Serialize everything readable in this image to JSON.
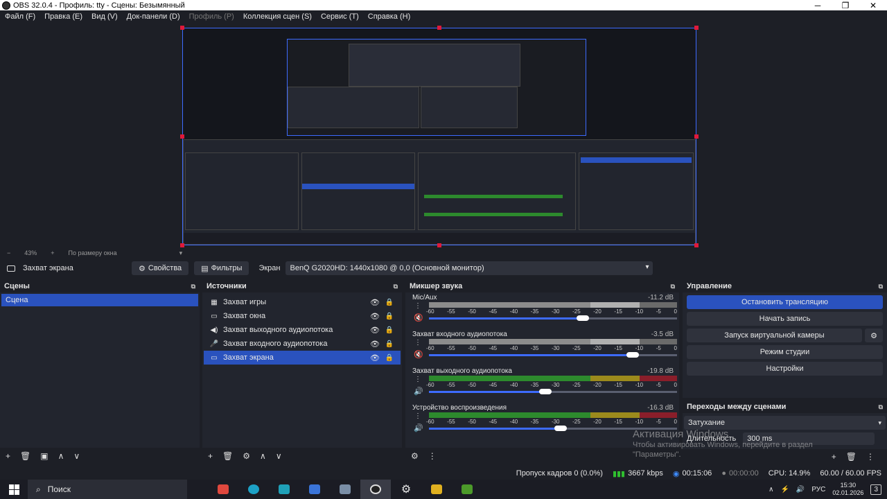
{
  "window": {
    "title": "OBS 32.0.4 - Профиль: tty - Сцены: Безымянный",
    "min": "─",
    "max": "❐",
    "close": "✕"
  },
  "menu": [
    "Файл (F)",
    "Правка (E)",
    "Вид (V)",
    "Док-панели (D)",
    "Профиль (P)",
    "Коллекция сцен (S)",
    "Сервис (T)",
    "Справка (H)"
  ],
  "zoom": {
    "minus": "−",
    "percent": "43%",
    "plus": "+",
    "fit_label": "По размеру окна",
    "arrow": "▾"
  },
  "context": {
    "source_name": "Захват экрана",
    "properties_label": "Свойства",
    "filters_label": "Фильтры",
    "screen_label": "Экран",
    "screen_value": "BenQ G2020HD: 1440x1080 @ 0,0 (Основной монитор)",
    "chevron": "▾"
  },
  "scenes": {
    "title": "Сцены",
    "popout": "⧉",
    "items": [
      "Сцена"
    ],
    "footer": [
      "+",
      "🗑",
      "▣",
      "∧",
      "∨"
    ]
  },
  "sources": {
    "title": "Источники",
    "popout": "⧉",
    "items": [
      {
        "icon": "▦",
        "label": "Захват игры",
        "eye": "👁",
        "lock": "🔒"
      },
      {
        "icon": "▭",
        "label": "Захват окна",
        "eye": "👁",
        "lock": "🔒"
      },
      {
        "icon": "◀)",
        "label": "Захват выходного аудиопотока",
        "eye": "👁",
        "lock": "🔒"
      },
      {
        "icon": "🎤",
        "label": "Захват входного аудиопотока",
        "eye": "👁",
        "lock": "🔒"
      },
      {
        "icon": "▭",
        "label": "Захват экрана",
        "eye": "👁",
        "lock": "🔒"
      }
    ],
    "footer": [
      "+",
      "🗑",
      "⚙",
      "∧",
      "∨"
    ]
  },
  "mixer": {
    "title": "Микшер звука",
    "popout": "⧉",
    "ticks": [
      "-60",
      "-55",
      "-50",
      "-45",
      "-40",
      "-35",
      "-30",
      "-25",
      "-20",
      "-15",
      "-10",
      "-5",
      "0"
    ],
    "channels": [
      {
        "name": "Mic/Aux",
        "db": "-11.2 dB",
        "menu": "⋮",
        "mute": "🔇",
        "volume": 0.62,
        "muted": true
      },
      {
        "name": "Захват входного аудиопотока",
        "db": "-3.5 dB",
        "menu": "⋮",
        "mute": "🔇",
        "volume": 0.82,
        "muted": true
      },
      {
        "name": "Захват выходного аудиопотока",
        "db": "-19.8 dB",
        "menu": "⋮",
        "mute": "🔊",
        "volume": 0.47,
        "muted": false
      },
      {
        "name": "Устройство воспроизведения",
        "db": "-16.3 dB",
        "menu": "⋮",
        "mute": "🔊",
        "volume": 0.53,
        "muted": false
      }
    ],
    "footer": [
      "⚙",
      "⋮"
    ]
  },
  "controls": {
    "title": "Управление",
    "popout": "⧉",
    "stop_stream": "Остановить трансляцию",
    "start_record": "Начать запись",
    "virtual_cam": "Запуск виртуальной камеры",
    "virtual_cam_gear": "⚙",
    "studio_mode": "Режим студии",
    "settings": "Настройки"
  },
  "transitions": {
    "title": "Переходы между сценами",
    "popout": "⧉",
    "type": "Затухание",
    "duration_label": "Длительность",
    "duration_value": "300 ms",
    "footer": [
      "+",
      "🗑",
      "⋮"
    ]
  },
  "watermark": {
    "line1": "Активация Windows",
    "line2": "Чтобы активировать Windows, перейдите в раздел",
    "line3": "\"Параметры\"."
  },
  "status": {
    "dropped": "Пропуск кадров 0 (0.0%)",
    "bitrate": "3667 kbps",
    "stream_time": "00:15:06",
    "rec_time": "00:00:00",
    "cpu": "CPU: 14.9%",
    "fps": "60.00 / 60.00 FPS"
  },
  "taskbar": {
    "search": "Поиск",
    "lang": "РУС",
    "time": "15:30",
    "date": "02.01.2026",
    "notif": "3"
  },
  "colors": {
    "accent": "#2a52be",
    "bg": "#1d1f26",
    "panel": "#22252e"
  }
}
